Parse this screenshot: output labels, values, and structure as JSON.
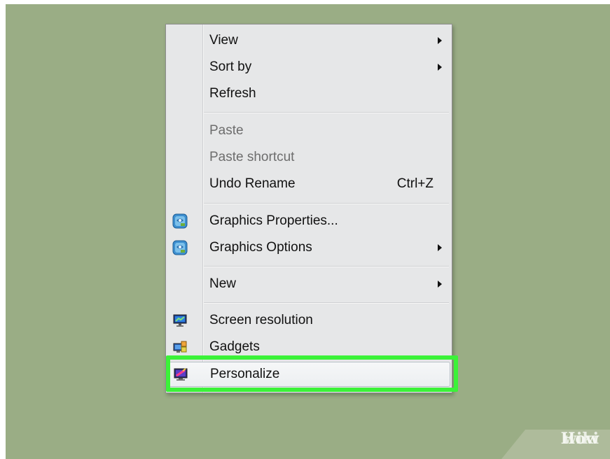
{
  "context_menu": {
    "items": [
      {
        "label": "View",
        "submenu": true
      },
      {
        "label": "Sort by",
        "submenu": true
      },
      {
        "label": "Refresh"
      },
      {
        "label": "Paste",
        "disabled": true
      },
      {
        "label": "Paste shortcut",
        "disabled": true
      },
      {
        "label": "Undo Rename",
        "shortcut": "Ctrl+Z"
      },
      {
        "label": "Graphics Properties...",
        "icon": "intel-graphics-icon"
      },
      {
        "label": "Graphics Options",
        "submenu": true,
        "icon": "intel-graphics-icon"
      },
      {
        "label": "New",
        "submenu": true
      },
      {
        "label": "Screen resolution",
        "icon": "monitor-icon"
      },
      {
        "label": "Gadgets",
        "icon": "gadgets-icon"
      },
      {
        "label": "Personalize",
        "icon": "personalize-icon",
        "highlighted": true
      }
    ]
  },
  "watermark": {
    "part1": "wiki",
    "part2": "How"
  },
  "colors": {
    "desktop_background": "#9aad85",
    "highlight_box": "#3bf238",
    "menu_background": "#e6e7e8"
  }
}
